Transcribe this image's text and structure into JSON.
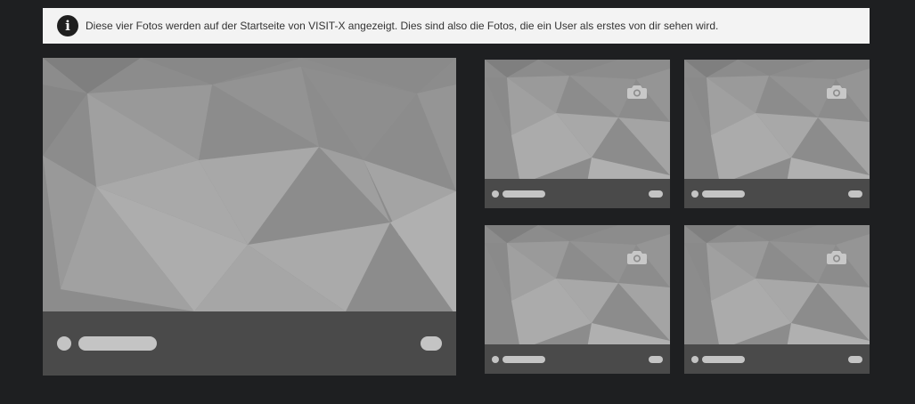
{
  "info": {
    "icon": "info-icon",
    "glyph": "i",
    "text": "Diese vier Fotos werden auf der Startseite von VISIT-X angezeigt. Dies sind also die Fotos, die ein User als erstes von dir sehen wird."
  },
  "photos": {
    "main": {
      "type": "large-placeholder"
    },
    "slots": [
      {
        "icon": "camera-icon"
      },
      {
        "icon": "camera-icon"
      },
      {
        "icon": "camera-icon"
      },
      {
        "icon": "camera-icon"
      }
    ]
  },
  "colors": {
    "background": "#1e1f21",
    "info_bar": "#f3f3f3",
    "placeholder": "#8f8f8f",
    "caption_bar": "#4a4a4a",
    "skeleton": "#c4c4c4"
  }
}
